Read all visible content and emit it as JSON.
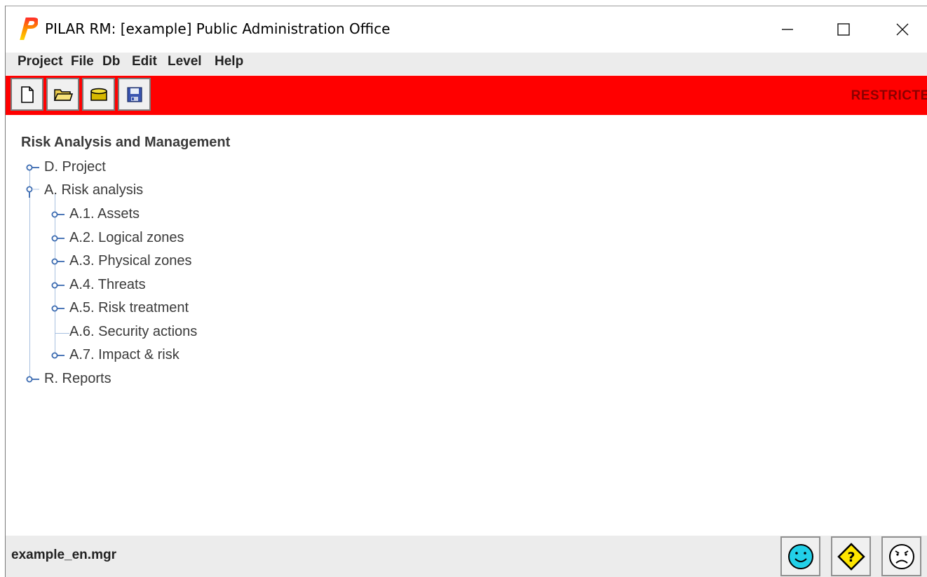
{
  "window": {
    "title": "PILAR RM: [example] Public Administration Office",
    "logo_letter": "P"
  },
  "menu": {
    "items": [
      "Project",
      "File",
      "Db",
      "Edit",
      "Level",
      "Help"
    ]
  },
  "toolbar": {
    "buttons": [
      {
        "icon": "new-document-icon"
      },
      {
        "icon": "open-folder-icon"
      },
      {
        "icon": "database-icon"
      },
      {
        "icon": "save-icon"
      }
    ],
    "classification": "RESTRICTED",
    "background_color": "#ff0000"
  },
  "tree": {
    "root": "Risk Analysis and Management",
    "nodes": [
      {
        "label": "D. Project"
      },
      {
        "label": "A. Risk analysis"
      },
      {
        "label": "A.1. Assets"
      },
      {
        "label": "A.2. Logical zones"
      },
      {
        "label": "A.3. Physical zones"
      },
      {
        "label": "A.4. Threats"
      },
      {
        "label": "A.5. Risk treatment"
      },
      {
        "label": "A.6. Security actions"
      },
      {
        "label": "A.7. Impact & risk"
      },
      {
        "label": "R. Reports"
      }
    ]
  },
  "status": {
    "filename": "example_en.mgr",
    "buttons": [
      {
        "icon": "happy-face-icon"
      },
      {
        "icon": "help-diamond-icon"
      },
      {
        "icon": "sad-face-icon"
      }
    ]
  }
}
